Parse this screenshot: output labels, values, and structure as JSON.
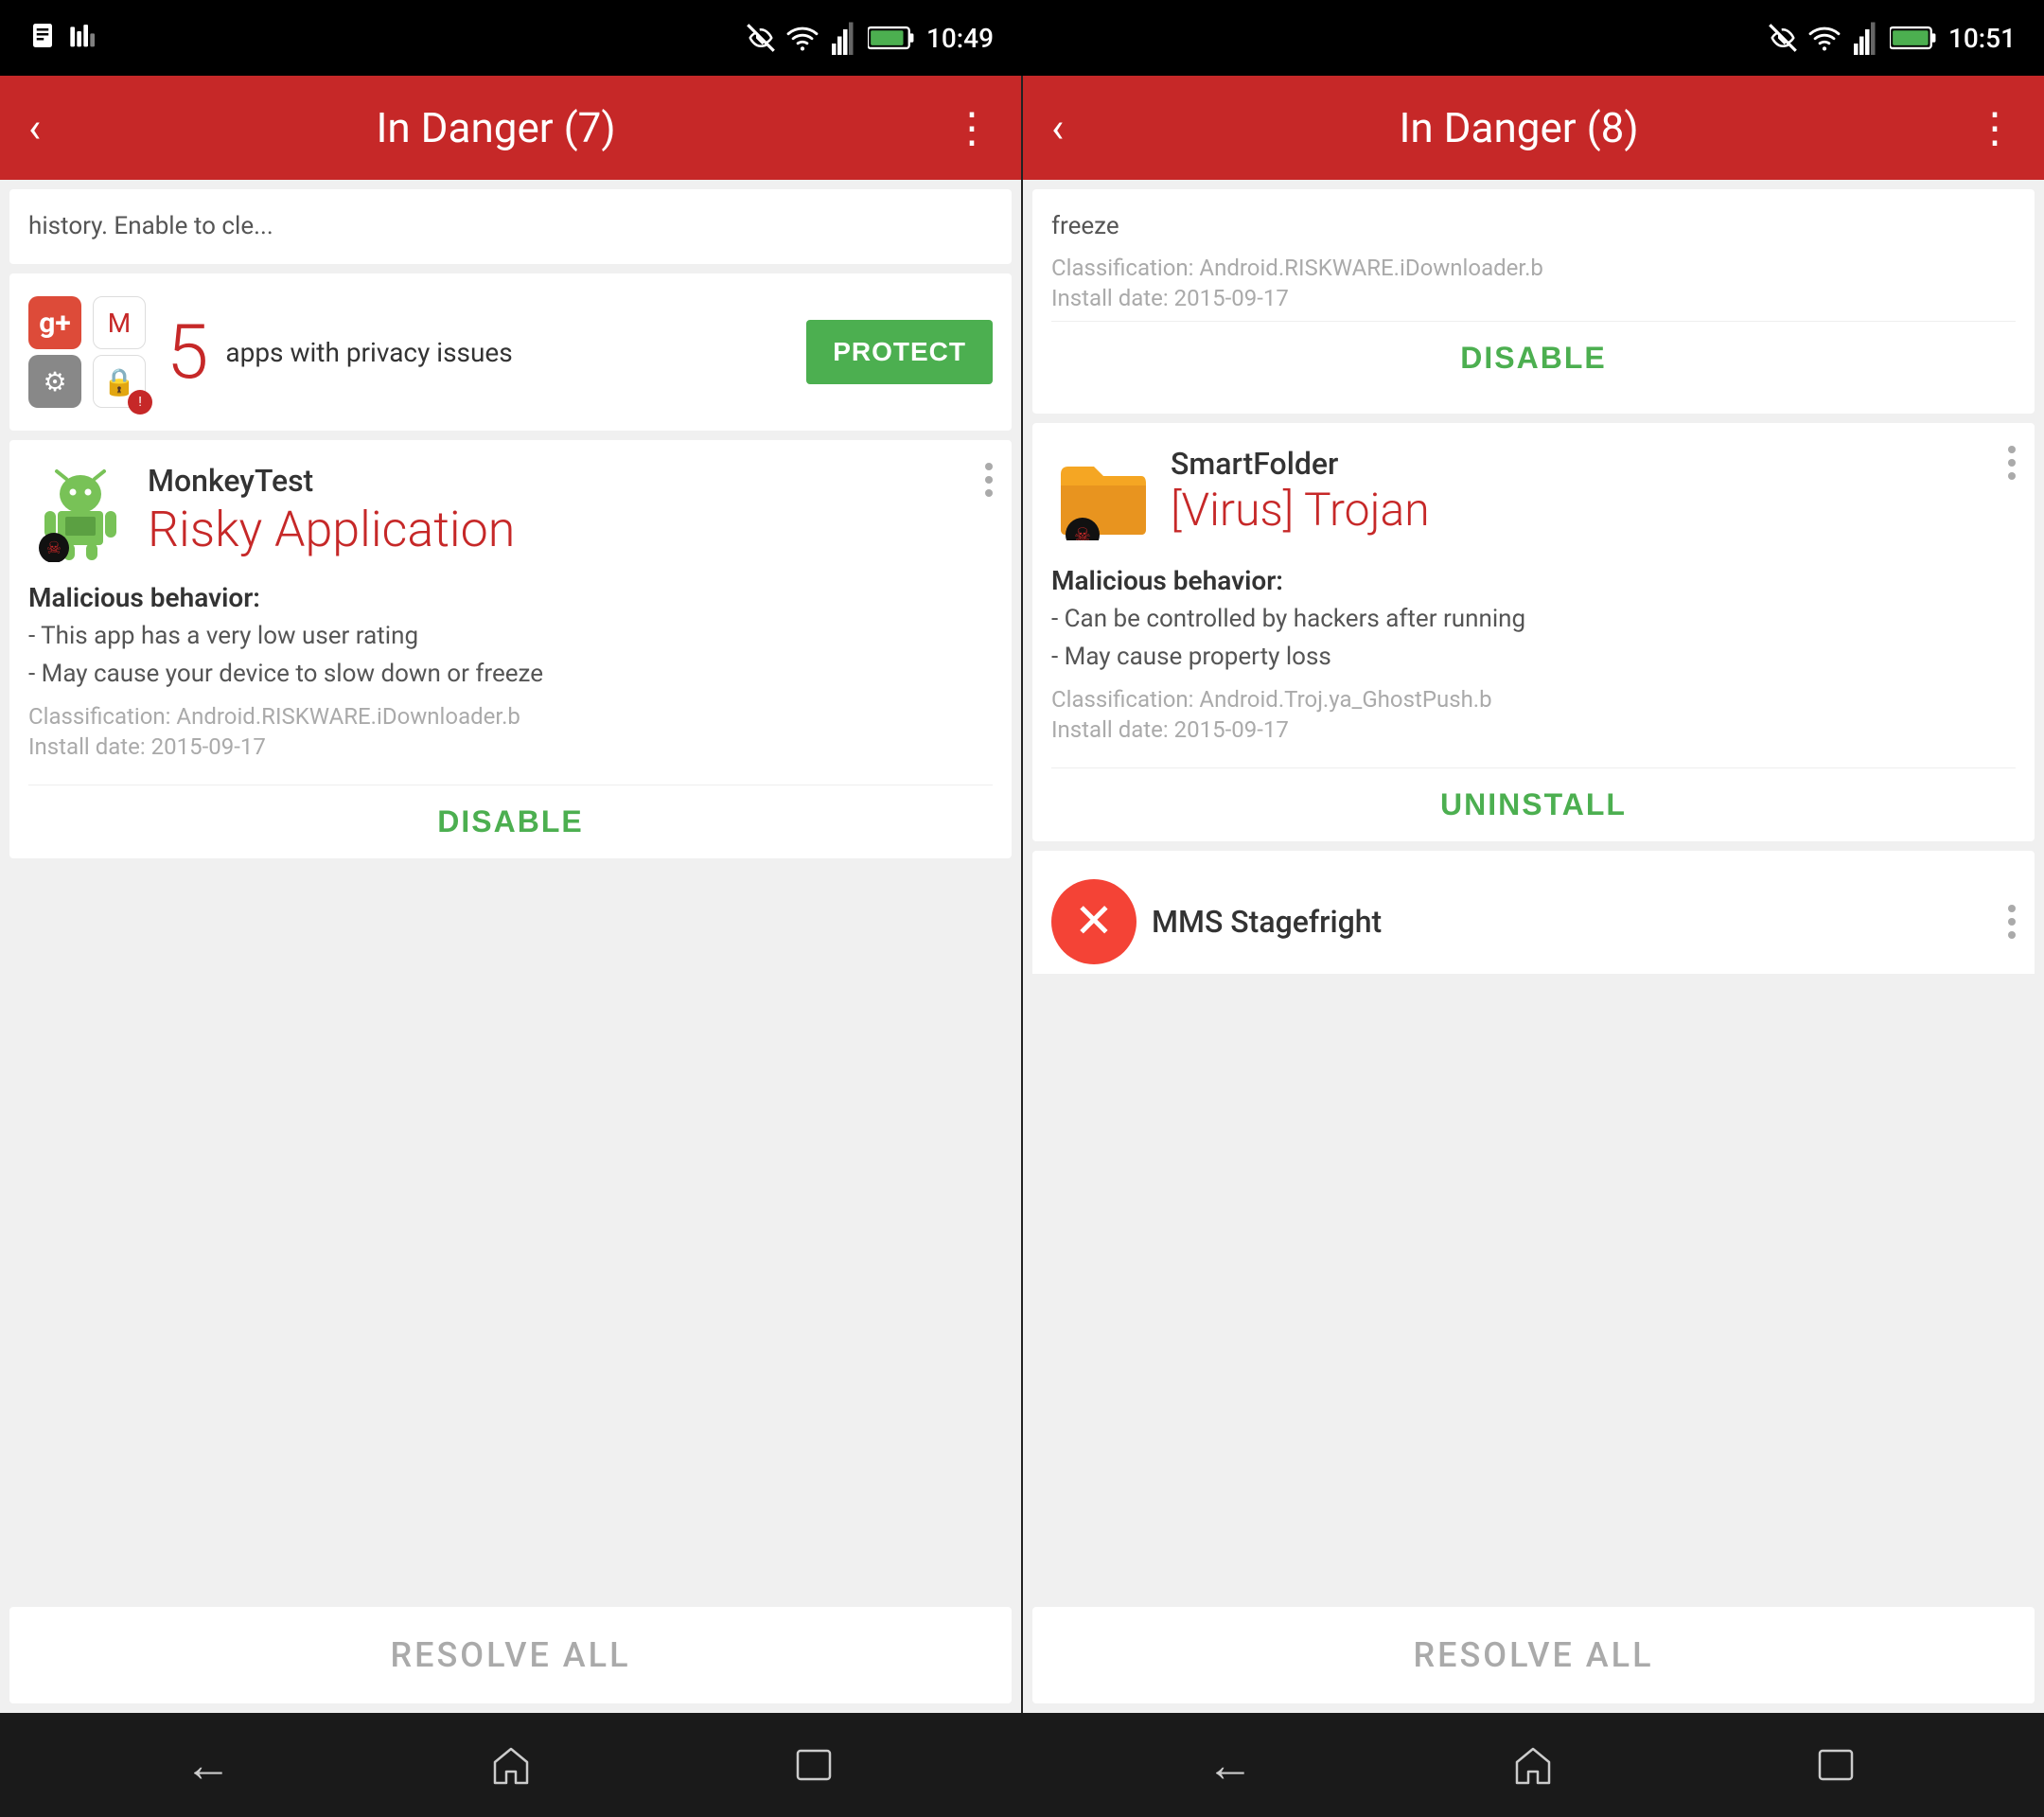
{
  "left_panel": {
    "status_bar": {
      "time": "10:49"
    },
    "header": {
      "title": "In Danger (7)",
      "back_label": "‹",
      "menu_label": "⋮"
    },
    "partial_top": {
      "text": "history. Enable to cle..."
    },
    "privacy_card": {
      "count": "5",
      "description": "apps with privacy issues",
      "protect_label": "PROTECT"
    },
    "monkey_card": {
      "app_name": "MonkeyTest",
      "status": "Risky Application",
      "behavior_title": "Malicious behavior:",
      "behaviors": [
        "- This app has a very low user rating",
        "- May cause your device to slow down or   freeze"
      ],
      "classification": "Classification: Android.RISKWARE.iDownloader.b",
      "install_date": "Install date: 2015-09-17",
      "action_label": "DISABLE"
    },
    "resolve_bar": {
      "label": "RESOLVE ALL"
    }
  },
  "right_panel": {
    "status_bar": {
      "time": "10:51"
    },
    "header": {
      "title": "In Danger (8)",
      "back_label": "‹",
      "menu_label": "⋮"
    },
    "partial_top": {
      "freeze_text": "freeze",
      "classification": "Classification: Android.RISKWARE.iDownloader.b",
      "install_date": "Install date: 2015-09-17",
      "action_label": "DISABLE"
    },
    "smartfolder_card": {
      "app_name": "SmartFolder",
      "status": "[Virus] Trojan",
      "behavior_title": "Malicious behavior:",
      "behaviors": [
        "- Can be controlled by hackers after running",
        "- May cause property loss"
      ],
      "classification": "Classification: Android.Troj.ya_GhostPush.b",
      "install_date": "Install date: 2015-09-17",
      "action_label": "UNINSTALL"
    },
    "partial_bottom": {
      "app_name": "MMS Stagefright"
    },
    "resolve_bar": {
      "label": "RESOLVE ALL"
    }
  },
  "nav": {
    "back_icon": "←",
    "home_icon": "⌂",
    "recents_icon": "▭"
  }
}
